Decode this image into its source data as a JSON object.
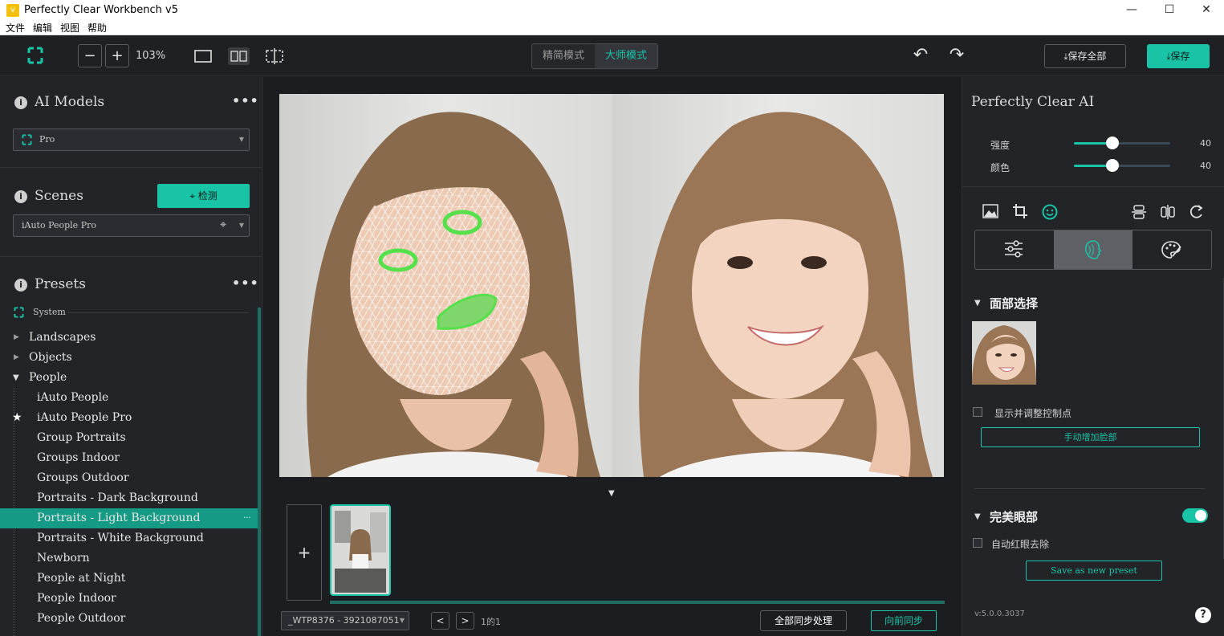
{
  "window": {
    "title": "Perfectly Clear Workbench v5",
    "icon_letter": "v",
    "minimize": "—",
    "maximize": "☐",
    "close": "✕"
  },
  "menu": [
    "文件",
    "编辑",
    "视图",
    "帮助"
  ],
  "toolbar": {
    "zoom_out": "−",
    "zoom_in": "+",
    "zoom_level": "103%",
    "mode_simple": "精简模式",
    "mode_master": "大师模式",
    "undo": "↶",
    "redo": "↷",
    "save_all": "保存全部",
    "save": "保存"
  },
  "ai_models": {
    "title": "AI Models",
    "menu": "•••",
    "selected": "Pro"
  },
  "scenes": {
    "title": "Scenes",
    "detect_label": "检测",
    "selected": "iAuto People Pro"
  },
  "presets": {
    "title": "Presets",
    "menu": "•••",
    "group": "System",
    "categories": [
      {
        "label": "Landscapes",
        "expanded": false
      },
      {
        "label": "Objects",
        "expanded": false
      },
      {
        "label": "People",
        "expanded": true
      }
    ],
    "items": [
      {
        "label": "iAuto People"
      },
      {
        "label": "iAuto People Pro",
        "starred": true
      },
      {
        "label": "Group Portraits"
      },
      {
        "label": "Groups Indoor"
      },
      {
        "label": "Groups Outdoor"
      },
      {
        "label": "Portraits - Dark Background"
      },
      {
        "label": "Portraits - Light Background",
        "active": true,
        "more": "···"
      },
      {
        "label": "Portraits - White Background"
      },
      {
        "label": "Newborn"
      },
      {
        "label": "People at Night"
      },
      {
        "label": "People Indoor"
      },
      {
        "label": "People Outdoor"
      }
    ]
  },
  "filmstrip": {
    "add": "+",
    "file_select": "_WTP8376 - 3921087051",
    "prev": "<",
    "next": ">",
    "page_info": "1的1",
    "sync_all": "全部同步处理",
    "sync_forward": "向前同步"
  },
  "right_panel": {
    "title": "Perfectly Clear AI",
    "sliders": [
      {
        "label": "强度",
        "value": 40,
        "display": "40"
      },
      {
        "label": "颜色",
        "value": 40,
        "display": "40"
      }
    ],
    "face_section": {
      "title": "面部选择",
      "show_points_label": "显示并调整控制点",
      "add_face_button": "手动增加脸部"
    },
    "eye_section": {
      "title": "完美眼部",
      "enabled": true,
      "red_eye_label": "自动红眼去除"
    },
    "save_preset_button": "Save as new preset",
    "version": "v:5.0.0.3037",
    "help": "?"
  },
  "colors": {
    "accent": "#19c3a6",
    "active_row": "#159a86",
    "panel": "#232428",
    "background": "#1f2024"
  }
}
